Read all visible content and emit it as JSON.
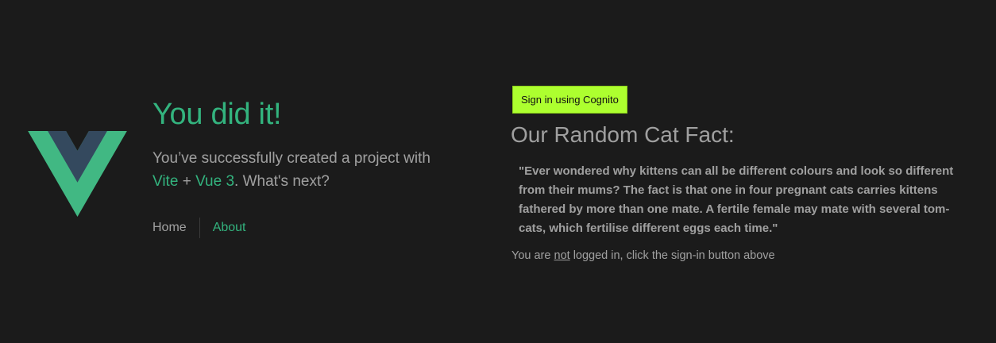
{
  "colors": {
    "background": "#1b1b1b",
    "accent_green": "#33b37e",
    "button_bg": "#adff2f",
    "text_muted": "#a6a6a6"
  },
  "hero": {
    "title": "You did it!",
    "subtitle_prefix": "You’ve successfully created a project with",
    "vite_link": "Vite",
    "plus": "+",
    "vue_link": "Vue 3",
    "subtitle_suffix": ". What's next?"
  },
  "nav": {
    "home": "Home",
    "about": "About"
  },
  "auth": {
    "signin_button": "Sign in using Cognito",
    "status_prefix": "You are",
    "status_not": "not",
    "status_suffix": "logged in, click the sign-in button above"
  },
  "cat_fact": {
    "heading": "Our Random Cat Fact:",
    "text": "\"Ever wondered why kittens can all be different colours and look so different from their mums? The fact is that one in four pregnant cats carries kittens fathered by more than one mate. A fertile female may mate with several tom-cats, which fertilise different eggs each time.\""
  },
  "icons": {
    "logo": "vue-logo-icon"
  }
}
